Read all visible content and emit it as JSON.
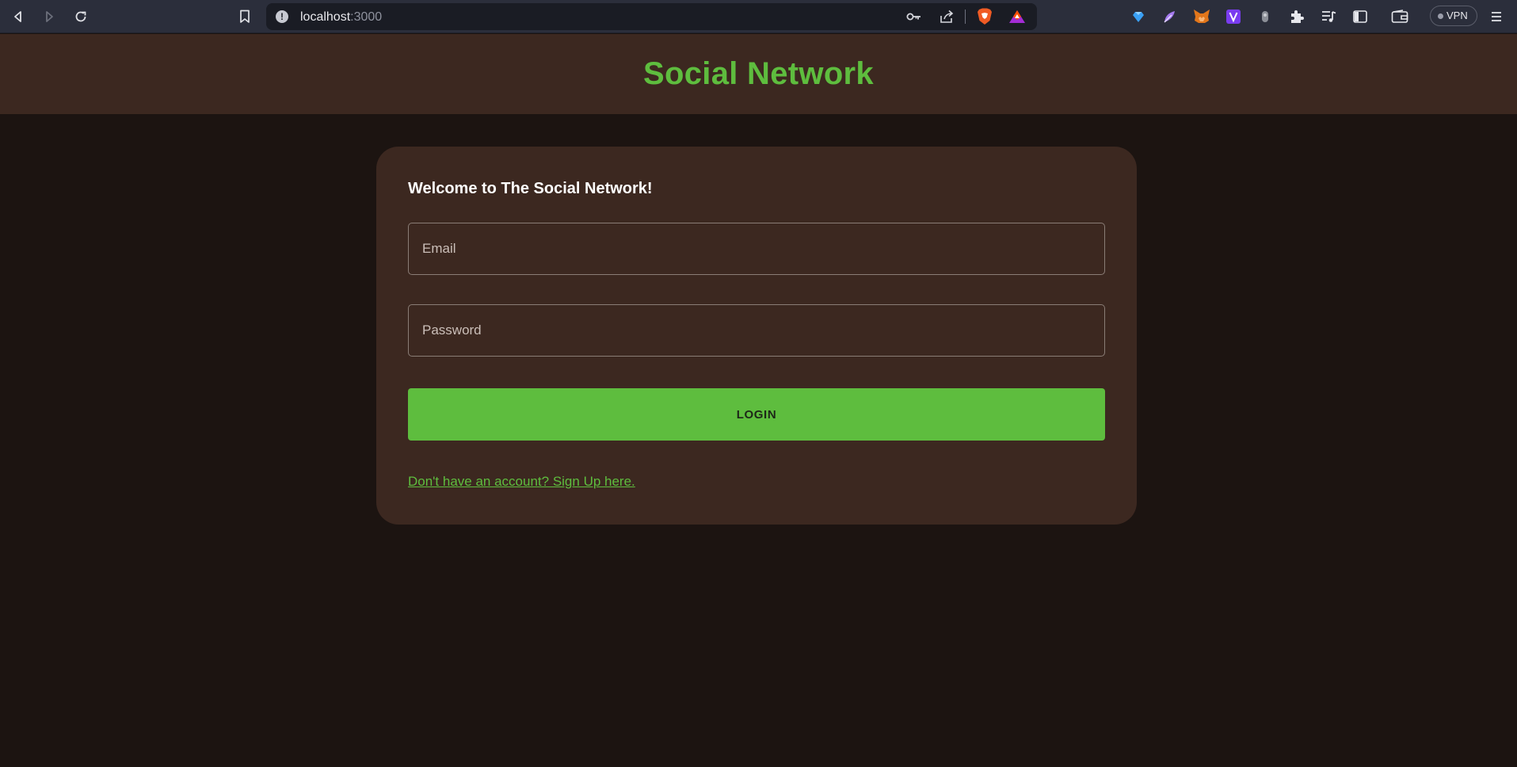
{
  "browser": {
    "url_host": "localhost",
    "url_port": ":3000",
    "vpn_label": "VPN",
    "extensions": [
      "brave-shields-icon",
      "bat-rewards-icon",
      "crystal-extension-icon",
      "feather-extension-icon",
      "metamask-fox-icon",
      "v-extension-icon",
      "grey-extension-icon",
      "extensions-puzzle-icon",
      "playlist-icon",
      "sidebar-toggle-icon",
      "wallet-icon",
      "menu-icon"
    ]
  },
  "header": {
    "title": "Social Network"
  },
  "login_card": {
    "welcome": "Welcome to The Social Network!",
    "email_placeholder": "Email",
    "password_placeholder": "Password",
    "login_label": "LOGIN",
    "signup_link": "Don't have an account? Sign Up here."
  },
  "colors": {
    "accent": "#5ebd3e",
    "page_bg": "#1c1411",
    "card_bg": "#3c2820"
  }
}
